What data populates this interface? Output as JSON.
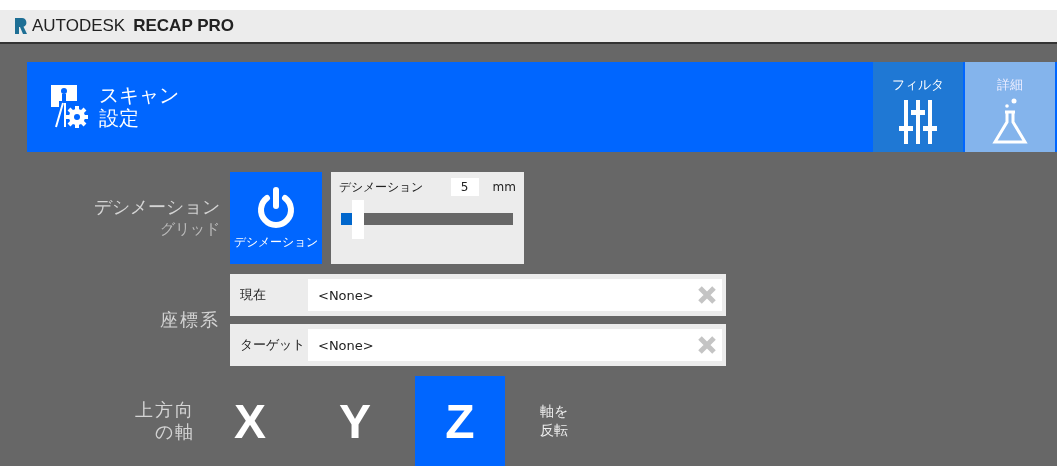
{
  "app_title": {
    "brand": "AUTODESK",
    "product": "RECAP PRO"
  },
  "header": {
    "title_lines": [
      "スキャン",
      "設定"
    ],
    "tabs": [
      {
        "label": "フィルタ",
        "kind": "filter",
        "selected": false
      },
      {
        "label": "詳細",
        "kind": "flask",
        "selected": true
      }
    ]
  },
  "decimation": {
    "label_lines": [
      "デシメーション",
      "グリッド"
    ],
    "toggle": {
      "label": "デシメーション",
      "on": true
    },
    "slider": {
      "label": "デシメーション",
      "value": "5",
      "unit": "mm",
      "level": 0.03
    }
  },
  "coordinate_system": {
    "label": "座標系",
    "fields": [
      {
        "label": "現在",
        "value": "<None>"
      },
      {
        "label": "ターゲット",
        "value": "<None>"
      }
    ]
  },
  "up_axis": {
    "label_lines": [
      "上方向",
      "の軸"
    ],
    "axes": [
      {
        "label": "X",
        "selected": false
      },
      {
        "label": "Y",
        "selected": false
      },
      {
        "label": "Z",
        "selected": true
      }
    ],
    "flip_lines": [
      "軸を",
      "反転"
    ]
  }
}
